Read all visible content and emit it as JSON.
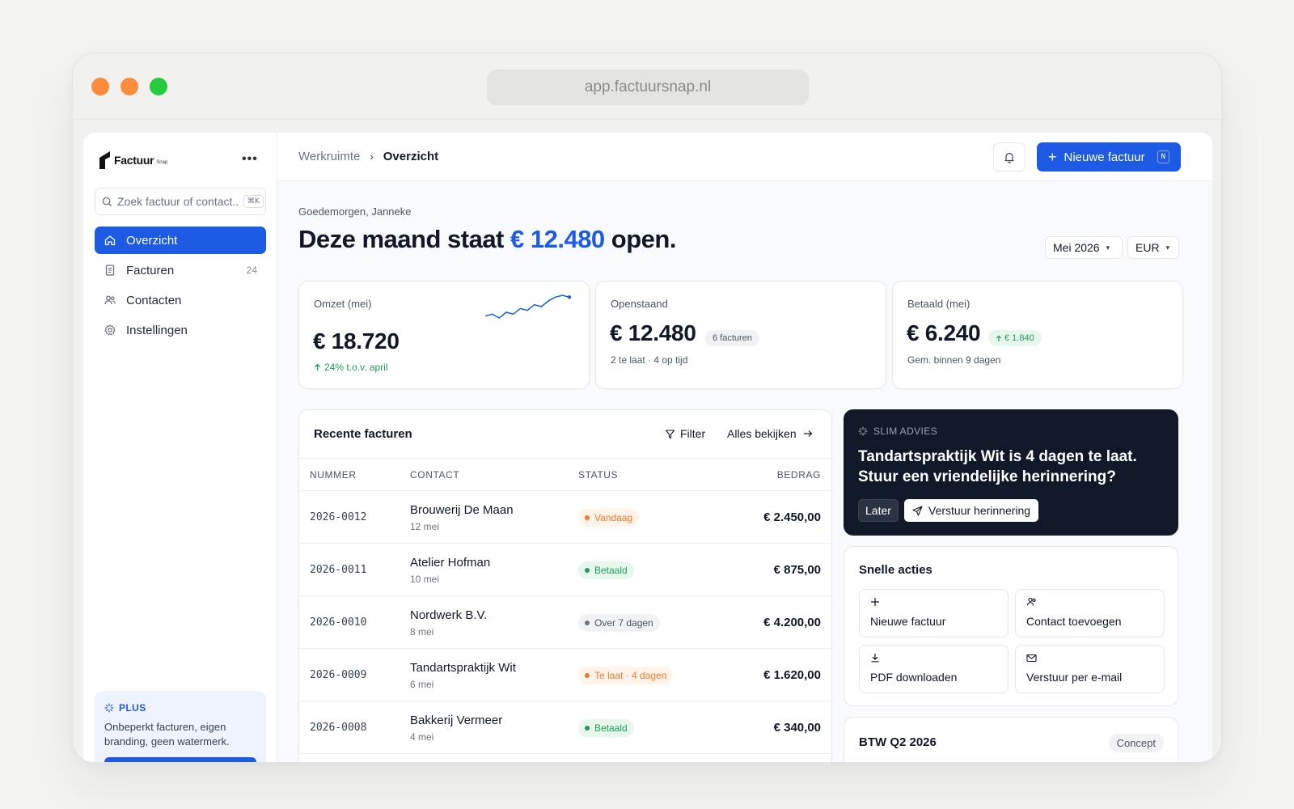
{
  "browser": {
    "url": "app.factuursnap.nl"
  },
  "colors": {
    "accent": "#1d5be4",
    "success": "#1f9d57",
    "warning": "#f07a2d",
    "neutral": "#6b7280",
    "dark": "#111827"
  },
  "sidebar": {
    "logo_text": "Factuur",
    "logo_sub": "Snap",
    "more_label": "•••",
    "search_placeholder": "Zoek factuur of contact...",
    "search_shortcut": "⌘K",
    "items": [
      {
        "label": "Overzicht",
        "icon": "home-icon",
        "active": true,
        "count": ""
      },
      {
        "label": "Facturen",
        "icon": "document-icon",
        "active": false,
        "count": "24"
      },
      {
        "label": "Contacten",
        "icon": "users-icon",
        "active": false,
        "count": ""
      },
      {
        "label": "Instellingen",
        "icon": "gear-icon",
        "active": false,
        "count": ""
      }
    ],
    "plus": {
      "title": "PLUS",
      "text": "Onbeperkt facturen, eigen branding, geen watermerk."
    }
  },
  "topbar": {
    "breadcrumb": [
      "Werkruimte",
      "Overzicht"
    ],
    "breadcrumb_sep": "›",
    "new_invoice_label": "Nieuwe factuur",
    "new_invoice_shortcut": "N"
  },
  "overview": {
    "greeting": "Goedemorgen, Janneke",
    "headline_prefix": "Deze maand staat ",
    "headline_amount": "€ 12.480",
    "headline_suffix": " open.",
    "month_select": "Mei 2026",
    "currency_select": "EUR"
  },
  "kpis": {
    "revenue": {
      "label": "Omzet (mei)",
      "value": "€ 18.720",
      "delta": "24% t.o.v. april",
      "sparkline": [
        3,
        4,
        2,
        5,
        4,
        7,
        6,
        9,
        8,
        11,
        13,
        14,
        13
      ]
    },
    "open": {
      "label": "Openstaand",
      "value": "€ 12.480",
      "badge": "6 facturen",
      "sub": "2 te laat · 4 op tijd"
    },
    "paid": {
      "label": "Betaald (mei)",
      "value": "€ 6.240",
      "badge": "€ 1.840",
      "sub": "Gem. binnen 9 dagen"
    }
  },
  "invoices": {
    "title": "Recente facturen",
    "filter_label": "Filter",
    "view_all_label": "Alles bekijken",
    "columns": {
      "number": "NUMMER",
      "contact": "CONTACT",
      "status": "STATUS",
      "amount": "BEDRAG"
    },
    "rows": [
      {
        "number": "2026-0012",
        "contact": "Brouwerij De Maan",
        "date": "12 mei",
        "status": "Vandaag",
        "tone": "warning",
        "amount": "€ 2.450,00"
      },
      {
        "number": "2026-0011",
        "contact": "Atelier Hofman",
        "date": "10 mei",
        "status": "Betaald",
        "tone": "success",
        "amount": "€ 875,00"
      },
      {
        "number": "2026-0010",
        "contact": "Nordwerk B.V.",
        "date": "8 mei",
        "status": "Over 7 dagen",
        "tone": "neutral",
        "amount": "€ 4.200,00"
      },
      {
        "number": "2026-0009",
        "contact": "Tandartspraktijk Wit",
        "date": "6 mei",
        "status": "Te laat · 4 dagen",
        "tone": "warning",
        "amount": "€ 1.620,00"
      },
      {
        "number": "2026-0008",
        "contact": "Bakkerij Vermeer",
        "date": "4 mei",
        "status": "Betaald",
        "tone": "success",
        "amount": "€ 340,00"
      }
    ]
  },
  "advice": {
    "label": "SLIM ADVIES",
    "text": "Tandartspraktijk Wit is 4 dagen te laat. Stuur een vriendelijke herinnering?",
    "later_label": "Later",
    "send_label": "Verstuur herinnering"
  },
  "quick_actions": {
    "title": "Snelle acties",
    "items": [
      {
        "label": "Nieuwe factuur",
        "icon": "plus-icon"
      },
      {
        "label": "Contact toevoegen",
        "icon": "add-user-icon"
      },
      {
        "label": "PDF downloaden",
        "icon": "download-icon"
      },
      {
        "label": "Verstuur per e-mail",
        "icon": "mail-icon"
      }
    ]
  },
  "btw": {
    "title": "BTW Q2 2026",
    "badge": "Concept"
  }
}
